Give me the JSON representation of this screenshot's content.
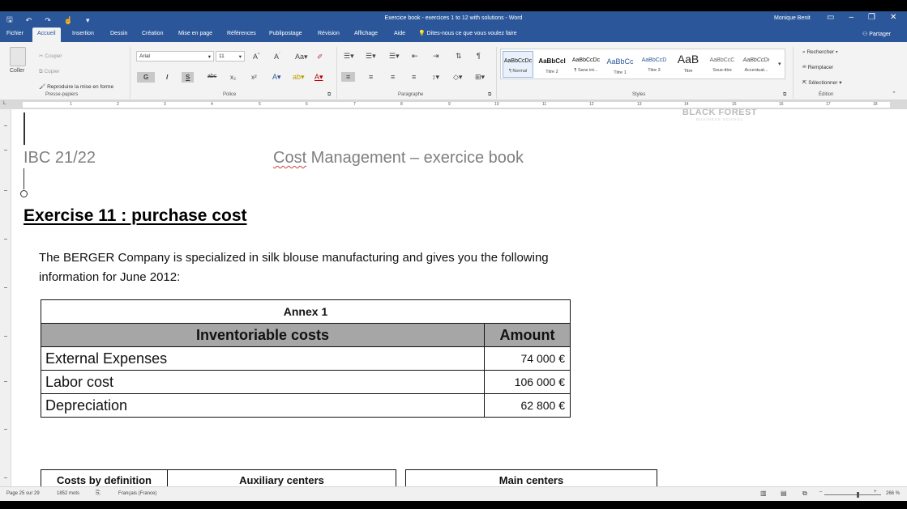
{
  "window": {
    "title": "Exercice book - exercices 1 to 12 with solutions  -  Word",
    "user": "Monique Benit",
    "qat": [
      "save-icon",
      "undo-icon",
      "redo-icon",
      "touch-mode-icon",
      "customize-icon"
    ]
  },
  "tabs": [
    "Fichier",
    "Accueil",
    "Insertion",
    "Dessin",
    "Création",
    "Mise en page",
    "Références",
    "Publipostage",
    "Révision",
    "Affichage",
    "Aide"
  ],
  "tell_me": "Dites-nous ce que vous voulez faire",
  "share": "Partager",
  "ribbon": {
    "clipboard": {
      "paste": "Coller",
      "cut": "Couper",
      "copy": "Copier",
      "format_painter": "Reproduire la mise en forme",
      "label": "Presse-papiers"
    },
    "font": {
      "name": "Arial",
      "size": "11",
      "label": "Police",
      "bold": "G",
      "italic": "I",
      "underline": "S",
      "strike": "abc"
    },
    "paragraph": {
      "label": "Paragraphe"
    },
    "styles": {
      "label": "Styles",
      "items": [
        {
          "preview": "AaBbCcDc",
          "name": "¶ Normal"
        },
        {
          "preview": "AaBbCcl",
          "name": "Titre 2"
        },
        {
          "preview": "AaBbCcDc",
          "name": "¶ Sans int..."
        },
        {
          "preview": "AaBbCc",
          "name": "Titre 1"
        },
        {
          "preview": "AaBbCcD",
          "name": "Titre 3"
        },
        {
          "preview": "AaB",
          "name": "Titre"
        },
        {
          "preview": "AaBbCcC",
          "name": "Sous-titre"
        },
        {
          "preview": "AaBbCcDı",
          "name": "Accentuat..."
        }
      ]
    },
    "editing": {
      "label": "Édition",
      "find": "Rechercher",
      "replace": "Remplacer",
      "select": "Sélectionner"
    }
  },
  "ruler": [
    "1",
    "2",
    "3",
    "4",
    "5",
    "6",
    "7",
    "8",
    "9",
    "10",
    "11",
    "12",
    "13",
    "14",
    "15",
    "16",
    "17",
    "18"
  ],
  "document": {
    "logo": {
      "line1": "BLACK FOREST",
      "line2": "BUSINESS SCHOOL"
    },
    "header_left": "IBC 21/22",
    "header_right_pre": "Cost",
    "header_right_post": " Management – exercice book",
    "exercise_title": "Exercise 11 : purchase cost",
    "intro_line1": "The BERGER Company is specialized in silk blouse manufacturing and gives you the following",
    "intro_line2": "information for June 2012:",
    "annex": {
      "title": "Annex 1",
      "headers": [
        "Inventoriable costs",
        "Amount"
      ],
      "rows": [
        {
          "label": "External  Expenses",
          "amount": "74 000 €"
        },
        {
          "label": "Labor cost",
          "amount": "106 000 €"
        },
        {
          "label": "Depreciation",
          "amount": "62 800 €"
        }
      ]
    },
    "table2_headers": [
      "Costs by definition",
      "Auxiliary centers",
      "Main centers"
    ]
  },
  "status": {
    "page": "Page 25 sur 29",
    "words": "1852 mots",
    "language": "Français (France)",
    "zoom": "266 %"
  }
}
